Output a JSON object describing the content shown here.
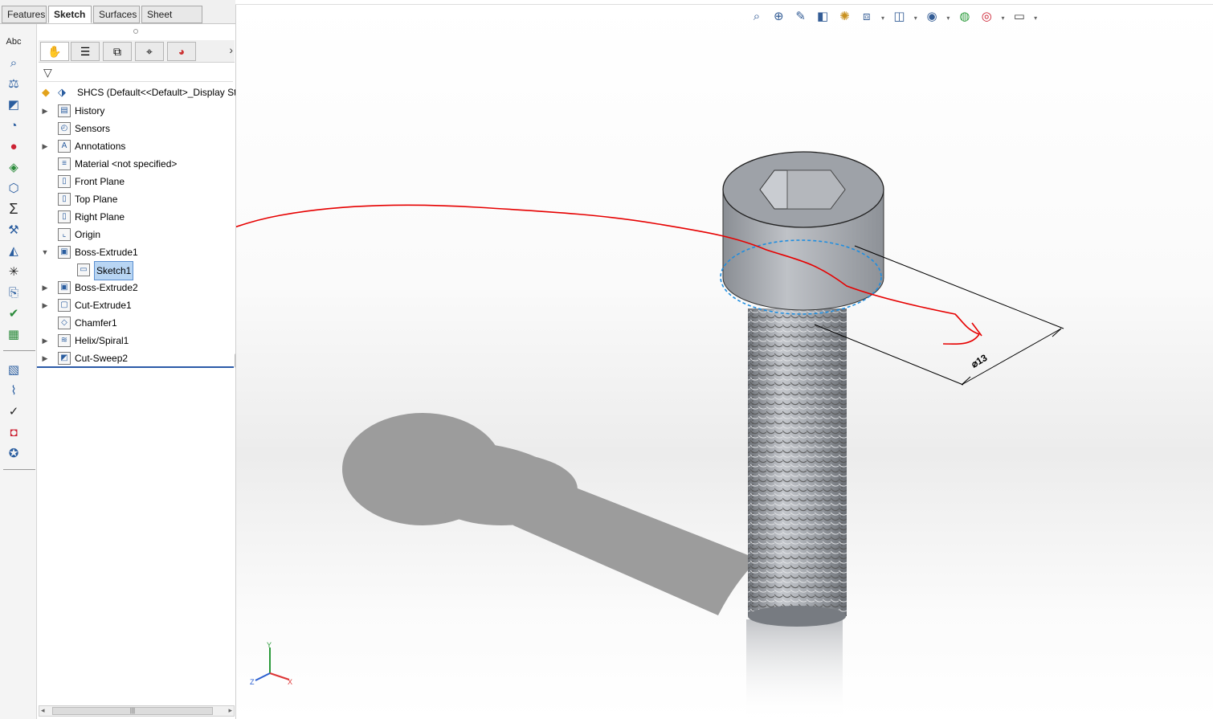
{
  "tabs": [
    {
      "label": "Features",
      "active": false
    },
    {
      "label": "Sketch",
      "active": true
    },
    {
      "label": "Surfaces",
      "active": false
    },
    {
      "label": "Sheet Metal",
      "active": false
    }
  ],
  "feature_tree": {
    "root_label": "SHCS  (Default<<Default>_Display St",
    "items": [
      {
        "label": "History",
        "expand": "collapsed",
        "icon": "history-folder-icon"
      },
      {
        "label": "Sensors",
        "expand": "none",
        "icon": "sensors-folder-icon"
      },
      {
        "label": "Annotations",
        "expand": "collapsed",
        "icon": "annotations-icon"
      },
      {
        "label": "Material <not specified>",
        "expand": "none",
        "icon": "material-icon"
      },
      {
        "label": "Front Plane",
        "expand": "none",
        "icon": "plane-icon"
      },
      {
        "label": "Top Plane",
        "expand": "none",
        "icon": "plane-icon"
      },
      {
        "label": "Right Plane",
        "expand": "none",
        "icon": "plane-icon"
      },
      {
        "label": "Origin",
        "expand": "none",
        "icon": "origin-icon"
      },
      {
        "label": "Boss-Extrude1",
        "expand": "expanded",
        "icon": "boss-extrude-icon"
      },
      {
        "label": "Sketch1",
        "expand": "none",
        "icon": "sketch-icon",
        "selected": true,
        "child": true
      },
      {
        "label": "Boss-Extrude2",
        "expand": "collapsed",
        "icon": "boss-extrude-icon"
      },
      {
        "label": "Cut-Extrude1",
        "expand": "collapsed",
        "icon": "cut-extrude-icon"
      },
      {
        "label": "Chamfer1",
        "expand": "none",
        "icon": "chamfer-icon"
      },
      {
        "label": "Helix/Spiral1",
        "expand": "collapsed",
        "icon": "helix-icon"
      },
      {
        "label": "Cut-Sweep2",
        "expand": "collapsed",
        "icon": "cut-sweep-icon"
      }
    ]
  },
  "strip_icons": {
    "top": [
      "spell-check-icon",
      "measure-icon",
      "mass-properties-icon",
      "section-properties-icon",
      "sensor-icon",
      "statistics-icon",
      "check-icon",
      "geometry-analysis-icon",
      "equations-icon",
      "thickness-analysis-icon",
      "draft-analysis-icon",
      "undercut-icon",
      "parting-line-icon",
      "curvature-icon",
      "deviation-icon"
    ],
    "bottom": [
      "zebra-stripes-icon",
      "sim-xpress-icon",
      "design-checker-icon",
      "sustainability-icon",
      "costing-icon"
    ]
  },
  "viewport": {
    "dimension_label": "⌀13",
    "axis_labels": {
      "x": "X",
      "y": "Y",
      "z": "Z"
    },
    "heads_up_icons": [
      "zoom-to-fit-icon",
      "zoom-area-icon",
      "previous-view-icon",
      "section-view-icon",
      "dynamic-annotation-icon",
      "view-orientation-icon",
      "display-style-icon",
      "hide-show-icon",
      "edit-appearance-icon",
      "apply-scene-icon",
      "view-settings-icon"
    ]
  },
  "colors": {
    "annotation_red": "#e60000",
    "selection_blue": "#1f8ee0",
    "bolt_steel": "#9ea2a8",
    "tree_selected": "#b8d5f3"
  }
}
